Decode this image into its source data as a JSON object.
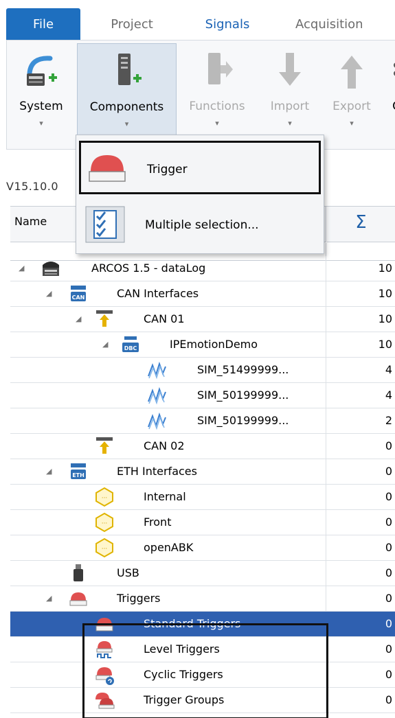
{
  "menu": {
    "tabs": [
      "File",
      "Project",
      "Signals",
      "Acquisition"
    ]
  },
  "ribbon": {
    "buttons": [
      {
        "label": "System",
        "icon": "system-icon"
      },
      {
        "label": "Components",
        "icon": "components-icon"
      },
      {
        "label": "Functions",
        "icon": "functions-icon"
      },
      {
        "label": "Import",
        "icon": "import-arrow-icon"
      },
      {
        "label": "Export",
        "icon": "export-arrow-icon"
      },
      {
        "label": "C",
        "icon": "more-icon"
      }
    ]
  },
  "dropdown": {
    "items": [
      {
        "label": "Trigger",
        "icon": "trigger-icon"
      },
      {
        "label": "Multiple selection...",
        "icon": "multiple-selection-icon"
      }
    ]
  },
  "version": "V15.10.0",
  "grid": {
    "name_header": "Name",
    "count_header": "Σ"
  },
  "tree": [
    {
      "label": "ARCOS 1.5 - dataLog",
      "count": "10",
      "icon": "device-icon",
      "expanded": true
    },
    {
      "label": "CAN Interfaces",
      "count": "10",
      "icon": "can-interfaces-icon",
      "expanded": true
    },
    {
      "label": "CAN 01",
      "count": "10",
      "icon": "can-port-icon",
      "expanded": true
    },
    {
      "label": "IPEmotionDemo",
      "count": "10",
      "icon": "dbc-icon",
      "expanded": true
    },
    {
      "label": "SIM_51499999...",
      "count": "4",
      "icon": "signal-icon"
    },
    {
      "label": "SIM_50199999...",
      "count": "4",
      "icon": "signal-icon"
    },
    {
      "label": "SIM_50199999...",
      "count": "2",
      "icon": "signal-icon"
    },
    {
      "label": "CAN 02",
      "count": "0",
      "icon": "can-port-icon"
    },
    {
      "label": "ETH Interfaces",
      "count": "0",
      "icon": "eth-interfaces-icon",
      "expanded": true
    },
    {
      "label": "Internal",
      "count": "0",
      "icon": "eth-port-icon"
    },
    {
      "label": "Front",
      "count": "0",
      "icon": "eth-port-icon"
    },
    {
      "label": "openABK",
      "count": "0",
      "icon": "eth-port-icon"
    },
    {
      "label": "USB",
      "count": "0",
      "icon": "usb-icon"
    },
    {
      "label": "Triggers",
      "count": "0",
      "icon": "trigger-icon",
      "expanded": true
    },
    {
      "label": "Standard Triggers",
      "count": "0",
      "icon": "trigger-icon",
      "selected": true
    },
    {
      "label": "Level Triggers",
      "count": "0",
      "icon": "level-trigger-icon"
    },
    {
      "label": "Cyclic Triggers",
      "count": "0",
      "icon": "cyclic-trigger-icon"
    },
    {
      "label": "Trigger Groups",
      "count": "0",
      "icon": "trigger-group-icon"
    }
  ],
  "colors": {
    "accent": "#1e6fbf",
    "selection": "#2f60b0",
    "trigger_red": "#e05050"
  }
}
